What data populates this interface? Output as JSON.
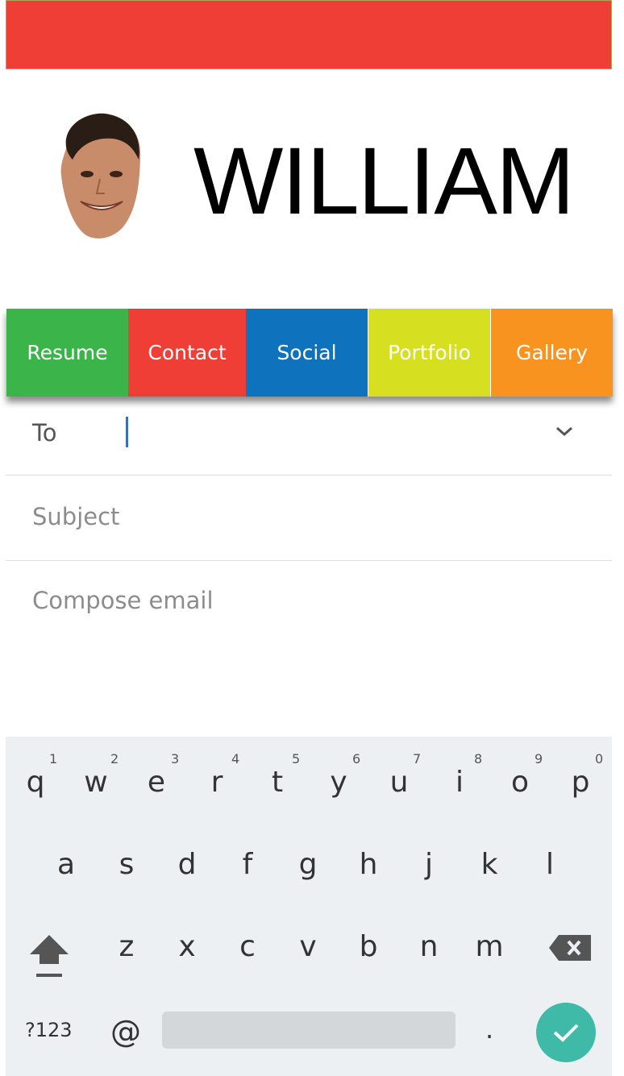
{
  "profile": {
    "name": "WILLIAM"
  },
  "nav": {
    "tabs": [
      {
        "label": "Resume",
        "color": "#3bb44a"
      },
      {
        "label": "Contact",
        "color": "#ef3e36"
      },
      {
        "label": "Social",
        "color": "#0e72bc"
      },
      {
        "label": "Portfolio",
        "color": "#d6e021"
      },
      {
        "label": "Gallery",
        "color": "#f7931e"
      }
    ]
  },
  "email": {
    "to_label": "To",
    "to_value": "",
    "subject_placeholder": "Subject",
    "compose_placeholder": "Compose email"
  },
  "keyboard": {
    "row1": [
      "q",
      "w",
      "e",
      "r",
      "t",
      "y",
      "u",
      "i",
      "o",
      "p"
    ],
    "row1_hints": [
      "1",
      "2",
      "3",
      "4",
      "5",
      "6",
      "7",
      "8",
      "9",
      "0"
    ],
    "row2": [
      "a",
      "s",
      "d",
      "f",
      "g",
      "h",
      "j",
      "k",
      "l"
    ],
    "row3": [
      "z",
      "x",
      "c",
      "v",
      "b",
      "n",
      "m"
    ],
    "symbols_label": "?123",
    "at_label": "@",
    "period_label": ".",
    "shift_icon": "shift-icon",
    "backspace_icon": "backspace-icon",
    "done_icon": "checkmark-icon",
    "done_color": "#3fb9a8"
  },
  "colors": {
    "header_bar": "#ef3e36",
    "keyboard_bg": "#edf0f3"
  }
}
